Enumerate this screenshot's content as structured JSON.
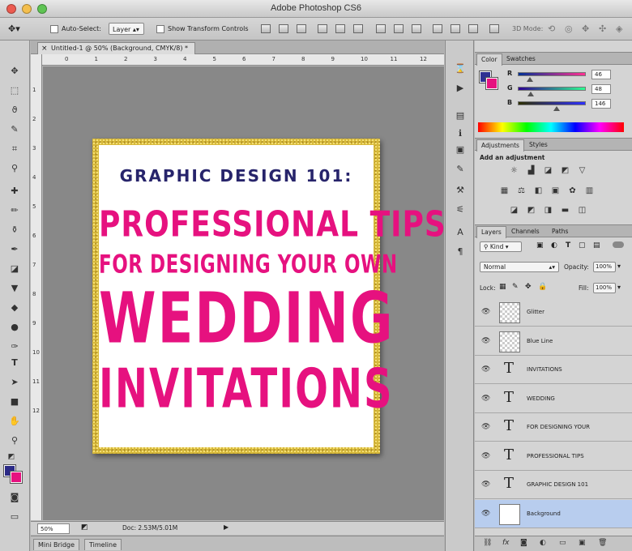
{
  "app": {
    "title": "Adobe Photoshop CS6"
  },
  "options": {
    "auto_select_label": "Auto-Select:",
    "auto_select_target": "Layer",
    "show_transform_label": "Show Transform Controls",
    "mode_3d_label": "3D Mode:"
  },
  "document": {
    "tab_title": "Untitled-1 @ 50% (Background, CMYK/8) *",
    "close_glyph": "×",
    "ruler_h": [
      "0",
      "1",
      "2",
      "3",
      "4",
      "5",
      "6",
      "7",
      "8",
      "9",
      "10",
      "11",
      "12"
    ],
    "ruler_v": [
      "1",
      "2",
      "3",
      "4",
      "5",
      "6",
      "7",
      "8",
      "9",
      "10",
      "11",
      "12"
    ],
    "zoom": "50%",
    "doc_size": "Doc: 2.53M/5.01M"
  },
  "artwork": {
    "line1": "GRAPHIC DESIGN 101:",
    "line2": "PROFESSIONAL TIPS",
    "line3": "FOR DESIGNING YOUR OWN",
    "line4": "WEDDING",
    "line5": "INVITATIONS",
    "colors": {
      "navy": "#27246b",
      "pink": "#e6117f",
      "glitter": "#d7b93b"
    }
  },
  "bottom_tabs": {
    "mini_bridge": "Mini Bridge",
    "timeline": "Timeline"
  },
  "color_panel": {
    "tab_color": "Color",
    "tab_swatches": "Swatches",
    "sliders": [
      {
        "label": "R",
        "value": "46",
        "fraction": 0.18
      },
      {
        "label": "G",
        "value": "48",
        "fraction": 0.19
      },
      {
        "label": "B",
        "value": "146",
        "fraction": 0.57
      }
    ],
    "fg_hex": "#2e3092",
    "bg_hex": "#e6117f"
  },
  "adjustments_panel": {
    "tab_adjustments": "Adjustments",
    "tab_styles": "Styles",
    "heading": "Add an adjustment"
  },
  "layers_panel": {
    "tab_layers": "Layers",
    "tab_channels": "Channels",
    "tab_paths": "Paths",
    "filter_kind": "Kind",
    "blend_mode": "Normal",
    "opacity_label": "Opacity:",
    "opacity_value": "100%",
    "lock_label": "Lock:",
    "fill_label": "Fill:",
    "fill_value": "100%",
    "layers": [
      {
        "name": "Glitter",
        "kind": "raster"
      },
      {
        "name": "Blue Line",
        "kind": "raster"
      },
      {
        "name": "INVITATIONS",
        "kind": "text"
      },
      {
        "name": "WEDDING",
        "kind": "text"
      },
      {
        "name": "FOR DESIGNING YOUR",
        "kind": "text"
      },
      {
        "name": "PROFESSIONAL TIPS",
        "kind": "text"
      },
      {
        "name": "GRAPHIC DESIGN 101",
        "kind": "text"
      },
      {
        "name": "Background",
        "kind": "background",
        "selected": true
      }
    ],
    "text_glyph": "T",
    "eye_glyph": "👁"
  }
}
